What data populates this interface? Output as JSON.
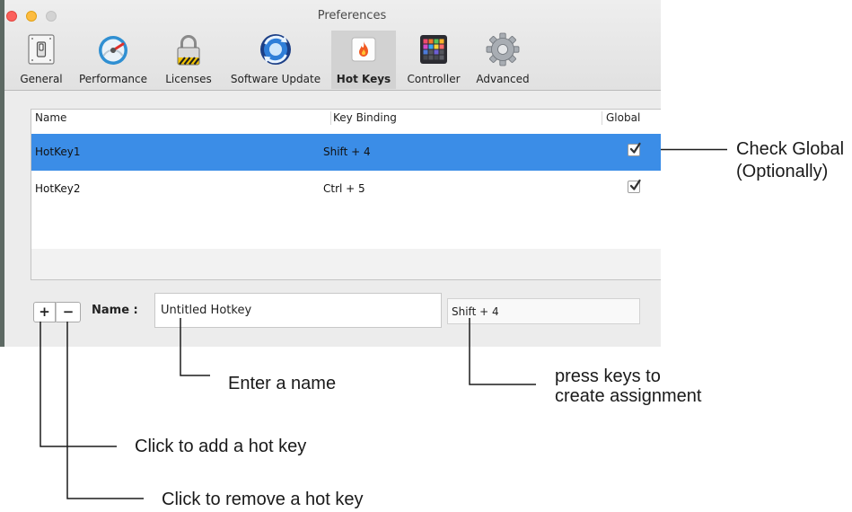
{
  "window": {
    "title": "Preferences"
  },
  "toolbar": {
    "items": [
      {
        "label": "General",
        "icon": "switch-icon",
        "selected": false
      },
      {
        "label": "Performance",
        "icon": "gauge-icon",
        "selected": false
      },
      {
        "label": "Licenses",
        "icon": "padlock-icon",
        "selected": false
      },
      {
        "label": "Software Update",
        "icon": "update-arrows-icon",
        "selected": false
      },
      {
        "label": "Hot Keys",
        "icon": "flame-icon",
        "selected": true
      },
      {
        "label": "Controller",
        "icon": "pad-grid-icon",
        "selected": false
      },
      {
        "label": "Advanced",
        "icon": "gear-icon",
        "selected": false
      }
    ]
  },
  "hotkeys_table": {
    "columns": {
      "name": "Name",
      "binding": "Key Binding",
      "global": "Global"
    },
    "rows": [
      {
        "name": "HotKey1",
        "binding": "Shift + 4",
        "global": true,
        "selected": true
      },
      {
        "name": "HotKey2",
        "binding": "Ctrl + 5",
        "global": true,
        "selected": false
      }
    ]
  },
  "editor": {
    "add_label": "+",
    "remove_label": "−",
    "name_label": "Name :",
    "name_value": "Untitled Hotkey",
    "binding_value": "Shift + 4"
  },
  "callouts": {
    "check_global": {
      "line1": "Check Global",
      "line2": "(Optionally)"
    },
    "enter_name": "Enter a name",
    "press_keys": {
      "line1": "press keys to",
      "line2": "create assignment"
    },
    "add_hotkey": "Click to add a hot key",
    "remove_hotkey": "Click to remove a hot key"
  },
  "colors": {
    "selection": "#3b8de7",
    "traffic_close": "#fc605c",
    "traffic_minimize": "#fdbc40",
    "traffic_zoom": "#d3d3d3"
  }
}
